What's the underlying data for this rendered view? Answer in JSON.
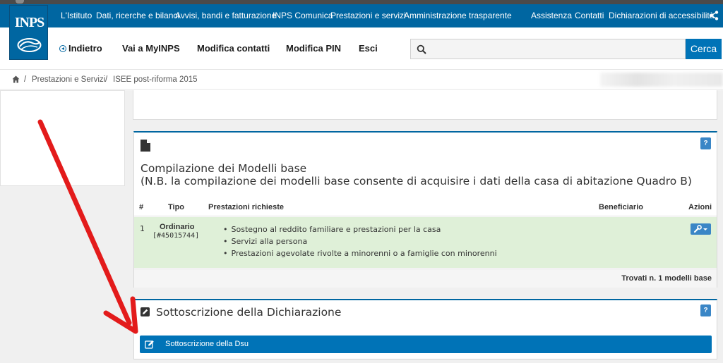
{
  "topnav": {
    "links": [
      "L'Istituto",
      "Dati, ricerche e bilanci",
      "Avvisi, bandi e fatturazione",
      "INPS Comunica",
      "Prestazioni e servizi",
      "Amministrazione trasparente"
    ],
    "right_links": [
      "Assistenza",
      "Contatti",
      "Dichiarazioni di accessibilità"
    ]
  },
  "logo": {
    "text": "INPS"
  },
  "subnav": {
    "back": "Indietro",
    "myinps": "Vai a MyINPS",
    "contatti": "Modifica contatti",
    "pin": "Modifica PIN",
    "esci": "Esci"
  },
  "search": {
    "placeholder": "",
    "button": "Cerca"
  },
  "breadcrumb": {
    "sep": "/",
    "items": [
      "Prestazioni e Servizi",
      "ISEE post-riforma 2015"
    ]
  },
  "modelli": {
    "help": "?",
    "title": "Compilazione dei Modelli base",
    "subtitle": "(N.B. la compilazione dei modelli base consente di acquisire i dati della casa di abitazione Quadro B)",
    "columns": {
      "num": "#",
      "tipo": "Tipo",
      "prestazioni": "Prestazioni richieste",
      "beneficiario": "Beneficiario",
      "azioni": "Azioni"
    },
    "rows": [
      {
        "num": "1",
        "tipo": "Ordinario",
        "id": "[#45015744]",
        "prestazioni": [
          "Sostegno al reddito familiare e prestazioni per la casa",
          "Servizi alla persona",
          "Prestazioni agevolate rivolte a minorenni o a famiglie con minorenni"
        ],
        "beneficiario": ""
      }
    ],
    "footer": "Trovati n. 1 modelli base"
  },
  "sottoscrizione": {
    "help": "?",
    "title": "Sottoscrizione della Dichiarazione",
    "button": "Sottoscrizione della Dsu"
  },
  "colors": {
    "brand": "#0066a1",
    "button": "#0073b7",
    "row_success": "#dff0d8",
    "annotation_arrow": "#e31b1b"
  },
  "icons": [
    "share-icon",
    "back-icon",
    "search-icon",
    "home-icon",
    "document-icon",
    "edit-icon",
    "wrench-icon",
    "caret-down-icon",
    "pencil-icon"
  ]
}
